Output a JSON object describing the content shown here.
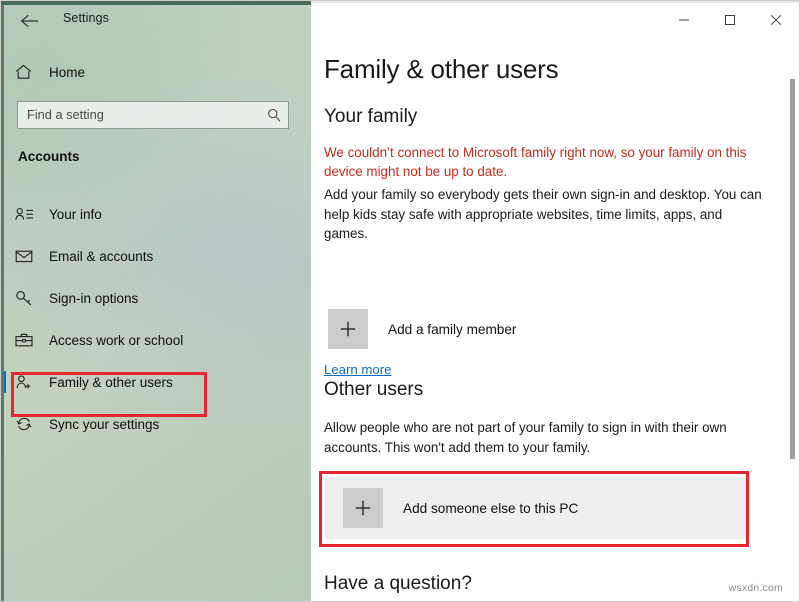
{
  "window": {
    "app_title": "Settings",
    "back_icon": "back-arrow-icon",
    "minimize_label": "−",
    "maximize_label": "□",
    "close_label": "✕"
  },
  "sidebar": {
    "home": {
      "label": "Home",
      "icon": "home-icon"
    },
    "search": {
      "value": "",
      "placeholder": "Find a setting",
      "icon": "search-icon"
    },
    "category_heading": "Accounts",
    "items": [
      {
        "label": "Your info",
        "icon": "user-info-icon",
        "selected": false
      },
      {
        "label": "Email & accounts",
        "icon": "envelope-icon",
        "selected": false
      },
      {
        "label": "Sign-in options",
        "icon": "key-icon",
        "selected": false
      },
      {
        "label": "Access work or school",
        "icon": "briefcase-icon",
        "selected": false
      },
      {
        "label": "Family & other users",
        "icon": "add-user-icon",
        "selected": true
      },
      {
        "label": "Sync your settings",
        "icon": "sync-icon",
        "selected": false
      }
    ]
  },
  "main": {
    "page_title": "Family & other users",
    "your_family": {
      "heading": "Your family",
      "warning": "We couldn’t connect to Microsoft family right now, so your family on this device might not be up to date.",
      "description": "Add your family so everybody gets their own sign-in and desktop. You can help kids stay safe with appropriate websites, time limits, apps, and games.",
      "add_button_label": "Add a family member",
      "add_button_icon": "plus-icon",
      "learn_more_label": "Learn more"
    },
    "other_users": {
      "heading": "Other users",
      "description": "Allow people who are not part of your family to sign in with their own accounts. This won't add them to your family.",
      "add_button_label": "Add someone else to this PC",
      "add_button_icon": "plus-icon"
    },
    "have_question_heading": "Have a question?"
  },
  "annotations": {
    "highlight_color": "#e8262f",
    "selection_color": "#0b6ec6",
    "link_color": "#0a6cbf",
    "warning_color": "#c42b1c"
  },
  "watermark": "wsxdn.com"
}
